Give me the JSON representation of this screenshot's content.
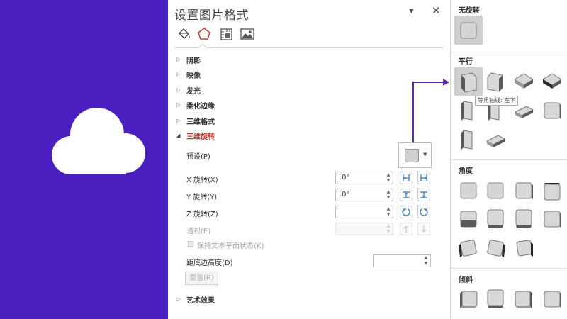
{
  "pane": {
    "title": "设置图片格式",
    "options_glyph": "▼",
    "close_glyph": "✕",
    "tabs": [
      {
        "name": "fill-line",
        "icon": "paint-bucket-icon"
      },
      {
        "name": "effects",
        "icon": "pentagon-icon",
        "active": true
      },
      {
        "name": "size-properties",
        "icon": "size-properties-icon"
      },
      {
        "name": "picture",
        "icon": "picture-icon"
      }
    ]
  },
  "sections": {
    "shadow": "阴影",
    "reflection": "映像",
    "glow": "发光",
    "soft_edges": "柔化边缘",
    "format_3d": "三维格式",
    "rotation_3d": "三维旋转",
    "artistic": "艺术效果"
  },
  "rotation": {
    "preset_label": "预设(P)",
    "x_label": "X 旋转(X)",
    "x_value": ".0°",
    "y_label": "Y 旋转(Y)",
    "y_value": ".0°",
    "z_label": "Z 旋转(Z)",
    "z_value": "",
    "perspective_label": "透视(E)",
    "perspective_value": "",
    "keep_flat_label": "保持文本平面状态(K)",
    "distance_label": "距底边高度(D)",
    "distance_value": "",
    "reset_label": "重置(R)"
  },
  "gallery": {
    "groups": [
      {
        "title": "无旋转",
        "count": 1
      },
      {
        "title": "平行",
        "count": 10
      },
      {
        "title": "角度",
        "count": 11
      },
      {
        "title": "倾斜",
        "count": 4
      }
    ],
    "tooltip": "等角轴线: 左下"
  },
  "colors": {
    "slide_bg": "#4b1fbf",
    "accent_arrow": "#5b2aa8",
    "active_section": "#c0392b"
  }
}
